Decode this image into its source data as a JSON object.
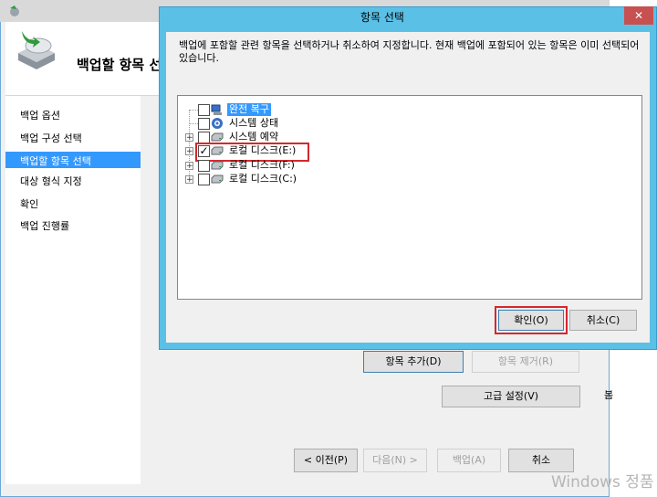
{
  "background_window": {
    "header_title": "백업할 항목 선",
    "nav_items": [
      "백업 옵션",
      "백업 구성 선택",
      "백업할 항목 선택",
      "대상 형식 지정",
      "확인",
      "백업 진행률"
    ],
    "buttons": {
      "add_items": "항목 추가(D)",
      "remove_items": "항목 제거(R)",
      "advanced": "고급 설정(V)",
      "prev": "< 이전(P)",
      "next": "다음(N) >",
      "backup": "백업(A)",
      "cancel": "취소"
    }
  },
  "desktop": {
    "watermark": "Windows 정품",
    "side_text": "봄"
  },
  "dialog": {
    "title": "항목 선택",
    "close": "✕",
    "description": "백업에 포함할 관련 항목을 선택하거나 취소하여 지정합니다. 현재 백업에 포함되어 있는 항목은 이미 선택되어 있습니다.",
    "tree": [
      {
        "label": "완전 복구",
        "checked": false,
        "expandable": false,
        "icon": "full-recovery-icon",
        "selected": true
      },
      {
        "label": "시스템 상태",
        "checked": false,
        "expandable": false,
        "icon": "system-state-icon",
        "selected": false
      },
      {
        "label": "시스템 예약",
        "checked": false,
        "expandable": true,
        "icon": "drive-icon",
        "selected": false
      },
      {
        "label": "로컬 디스크(E:)",
        "checked": true,
        "expandable": true,
        "icon": "drive-icon",
        "selected": false
      },
      {
        "label": "로컬 디스크(F:)",
        "checked": false,
        "expandable": true,
        "icon": "drive-icon",
        "selected": false
      },
      {
        "label": "로컬 디스크(C:)",
        "checked": false,
        "expandable": true,
        "icon": "drive-icon",
        "selected": false
      }
    ],
    "ok_button": "확인(O)",
    "cancel_button": "취소(C)"
  },
  "colors": {
    "dialog_frame": "#5bc0e6",
    "selection": "#3399ff",
    "highlight_box": "#d4282d",
    "close_button": "#c75050"
  }
}
